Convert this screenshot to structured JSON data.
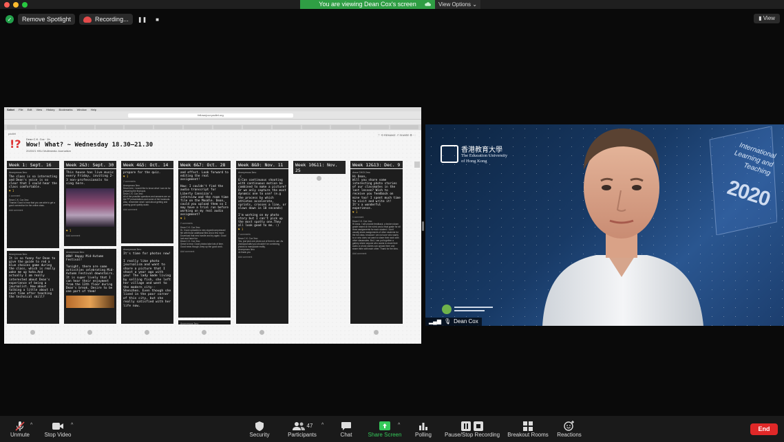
{
  "window": {
    "share_banner": "You are viewing Dean Cox's screen",
    "view_options": "View Options",
    "view_button": "View"
  },
  "top_controls": {
    "spotlight": "Remove Spotlight",
    "recording": "Recording..."
  },
  "shared_screen": {
    "menubar": [
      "Safari",
      "File",
      "Edit",
      "View",
      "History",
      "Bookmarks",
      "Window",
      "Help"
    ],
    "url": "fellowcjour.padlet.org",
    "padlet": {
      "logo": "padlet",
      "meta": "Dean C.K. Cox · 1h",
      "title": "Wow! What? ~ Wednesday 18.30–21.30",
      "subtitle": "2020/21 HKU Multimedia Journalism",
      "actions": "♡  ⟲ REMAKE   ↗ SHARE   ⚙  ···",
      "columns": [
        {
          "title": "Week 1: Sept. 16",
          "cards": [
            {
              "author": "Anonymous 3mo",
              "body": "The class is so interesting and Dean's voice is so clear that I could hear the class comfortable.",
              "likes": "♥ 1",
              "comments": "1 comment",
              "reply": "Dean C.K. Cox 3mo\nThanks! Good to hear that you are able to get a good connection for the online class.",
              "add": "Add comment"
            },
            {
              "author": "Anonymous 3mo",
              "body": "It is so funny for Dean to give the guide to red a blue choices game during the class, which is really wake me up haha.And actually I am really interested about Dean's experience of being a journalist. How about talking a little about it next time after teaching the technical skill?"
            }
          ]
        },
        {
          "title": "Week 2&3: Sept. 30",
          "cards": [
            {
              "author": "",
              "body": "This house has live music every Friday, inviting 2-3 non-professionals to sing here.",
              "likes": "♥ 1",
              "add": "Add comment"
            },
            {
              "author": "Anonymous 3mo",
              "body": "WOW! Happy Mid-Autumn Festival!\n\nTonight, there are some activities celebrating Mid-Autumn Festival downstairs. It is super lively that I can hear their enjoyment from the 13th floor during Dean's break. Desire to be one part of them!"
            }
          ]
        },
        {
          "title": "Week 4&5: Oct. 14",
          "cards": [
            {
              "author": "",
              "body": "prepare for the quiz.",
              "likes": "♥ 1",
              "comments": "2 comments",
              "reply": "Anonymous 3mo\nDean here, I would like to know what I can do for preparing the final quiz.\nDean C.K. Cox 3mo\nAll of the possible questions and answers are on the PP presentations and some of the handouts. Also, remember what I said about getting and posting good quality audio.",
              "add": "Add comment"
            },
            {
              "author": "Anonymous 3mo",
              "body": "It's time for photos now!\n\nI really like photo journalism and want to share a picture that I shoot a year ago with you! The lady made living by selling fish, she left her village and went to the modern city-- Shenzhen. Even though she lived in the poor corner of this city, but she really satisfied with her life now."
            }
          ]
        },
        {
          "title": "Week 6&7: Oct. 28",
          "cards": [
            {
              "author": "",
              "body": "and effect. Look forward to editing the real assignment!\n\nHow: I couldn't find the audio transcript for Liberty Cannizzo's interview and the room time file on the Moodle. Dean, could you upload them so I may have a trial run before working on my real audio assignment?",
              "likes": "♥ 1",
              "comments": "2 comments",
              "reply": "Dean C.K. Cox 3mo\nHi, I have uploaded a new zipped/compressed file with those additional files and a few more. Download that new bundle and try again. Good luck and have fun.\nDean C.K. Cox 3mo\nGreat to hear. Good photos take lots of time. Good news though, keep up the good work.",
              "add": "Add comment"
            },
            {
              "author": "Anonymous 3mo",
              "body": ""
            }
          ]
        },
        {
          "title": "Week 8&9: Nov. 11",
          "cards": [
            {
              "author": "Anonymous 3mo",
              "body": ":(\nQ:Can continuous shooting with continuous motion be combined to make a picture? Or we only capture the most dynamic one to use? (e.g the process by which athletes accelerate, sprints, crosses a line, or slows down in 10 seconds)\n\nI'm working on my photo story but I can't pick up the most spotty one.They all look good to me. :)",
              "likes": "♥ 1",
              "comments": "2 comments",
              "reply": "Dean C.K. Cox 3mo\nYes, just pick one photo out of them to use. As photojournalist you shouldn't be combining photos to manipulate reality.\nAnonymous 3mo\nok thank you",
              "add": "Add comment"
            }
          ]
        },
        {
          "title": "Week 10&11: Nov. 25",
          "cards": []
        },
        {
          "title": "Week 12&13: Dec. 9",
          "cards": [
            {
              "author": "Anna CHOI 2mo",
              "body": "Hi Dean,\nWill you share some interesting photo stories of our classmates in the last lesson? Wish to receive you feedback on mine too! I spent much time to visit and write it!\nIt's a wonderful experience.",
              "likes": "♥ 1",
              "comments": "1 comment",
              "reply": "Dean C.K. Cox 1mo\nHi Anna. I will provide feedback, a broken down grade based on the rubric and a final grade for all three assignments for each student. I don't usually share assignments of other students for the full class, because I am not sure who wants to or who does not want to share their work with other classmates. But, I can put together a gallery where anyone who wants to share their audio or photo stories can upload them and share them with each other. Thank for the idea.",
              "add": "Add comment"
            }
          ]
        }
      ]
    }
  },
  "video": {
    "participant_name": "Dean Cox",
    "background_cn": "香港教育大學",
    "background_en": "The Education University of Hong Kong",
    "conference_text": "International Learning and Teaching",
    "conference_year": "2020"
  },
  "toolbar": {
    "buttons": [
      {
        "label": "Unmute"
      },
      {
        "label": "Stop Video"
      },
      {
        "label": "Security"
      },
      {
        "label": "Participants",
        "count": "47"
      },
      {
        "label": "Chat"
      },
      {
        "label": "Share Screen"
      },
      {
        "label": "Polling"
      },
      {
        "label": "Pause/Stop Recording"
      },
      {
        "label": "Breakout Rooms"
      },
      {
        "label": "Reactions"
      }
    ],
    "end": "End"
  },
  "colors": {
    "share_green": "#2f9e44",
    "end_red": "#e02828",
    "card_dark": "#1d1d1d"
  }
}
